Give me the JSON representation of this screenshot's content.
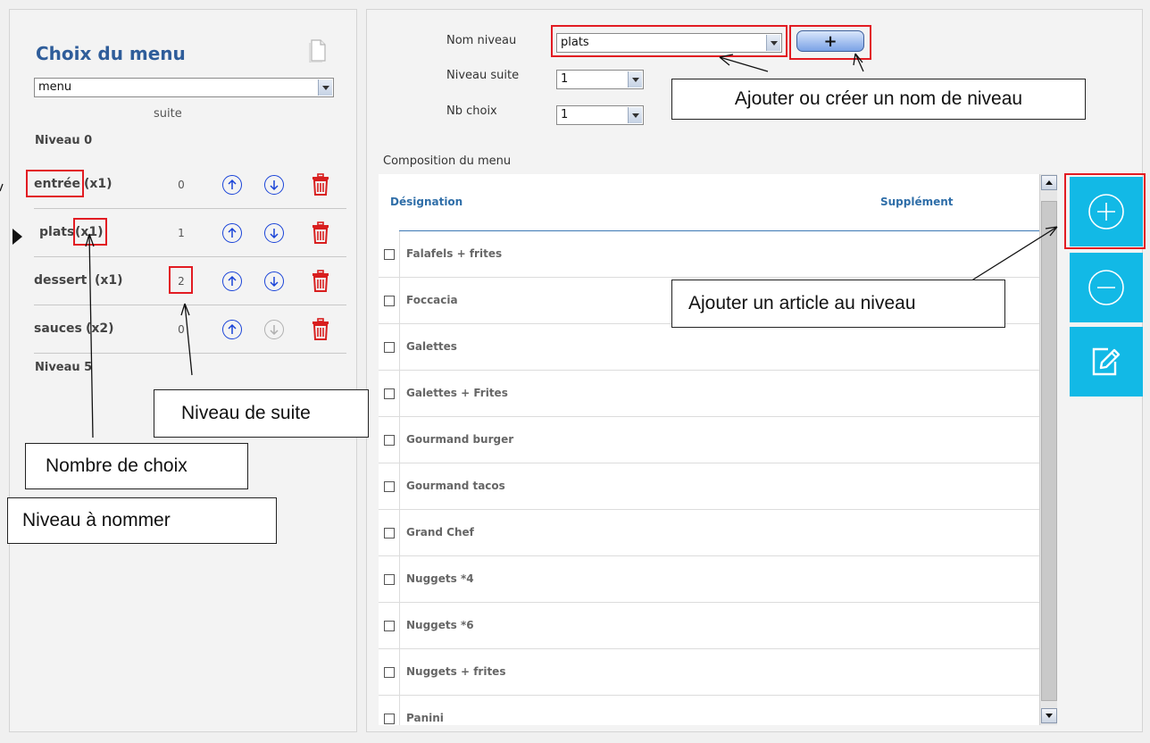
{
  "menu_panel": {
    "title": "Choix du menu",
    "menu_select_value": "menu",
    "suite_header": "suite",
    "level_start": "Niveau 0",
    "level_end": "Niveau 5",
    "levels": [
      {
        "name": "entrée",
        "count": "(x1)",
        "suite": "0"
      },
      {
        "name": "plats",
        "count": "(x1)",
        "suite": "1"
      },
      {
        "name": "dessert",
        "count": "(x1)",
        "suite": "2"
      },
      {
        "name": "sauces",
        "count": "(x2)",
        "suite": "0"
      }
    ]
  },
  "level_form": {
    "nom_niveau_label": "Nom niveau",
    "nom_niveau_value": "plats",
    "add_button_label": "+",
    "niveau_suite_label": "Niveau suite",
    "niveau_suite_value": "1",
    "nb_choix_label": "Nb choix",
    "nb_choix_value": "1"
  },
  "composition": {
    "label": "Composition du menu",
    "columns": [
      "Désignation",
      "Supplément"
    ],
    "items": [
      "Falafels + frites",
      "Foccacia",
      "Galettes",
      "Galettes + Frites",
      "Gourmand burger",
      "Gourmand tacos",
      "Grand Chef",
      "Nuggets *4",
      "Nuggets *6",
      "Nuggets + frites",
      "Panini"
    ]
  },
  "callouts": {
    "add_level_name": "Ajouter ou créer un nom de niveau",
    "add_article": "Ajouter un article au niveau",
    "niveau_de_suite": "Niveau de suite",
    "nombre_de_choix": "Nombre de choix",
    "niveau_a_nommer": "Niveau à nommer"
  },
  "colors": {
    "title": "#2f5d9a",
    "action_button": "#12b9e6",
    "highlight": "#e21b22",
    "arrow_button": "#1a44d8",
    "trash": "#d81e1e"
  },
  "icons": [
    "document-icon",
    "chevron-down-icon",
    "arrow-up-icon",
    "arrow-down-icon",
    "trash-icon",
    "plus-circle-icon",
    "minus-circle-icon",
    "edit-icon"
  ]
}
